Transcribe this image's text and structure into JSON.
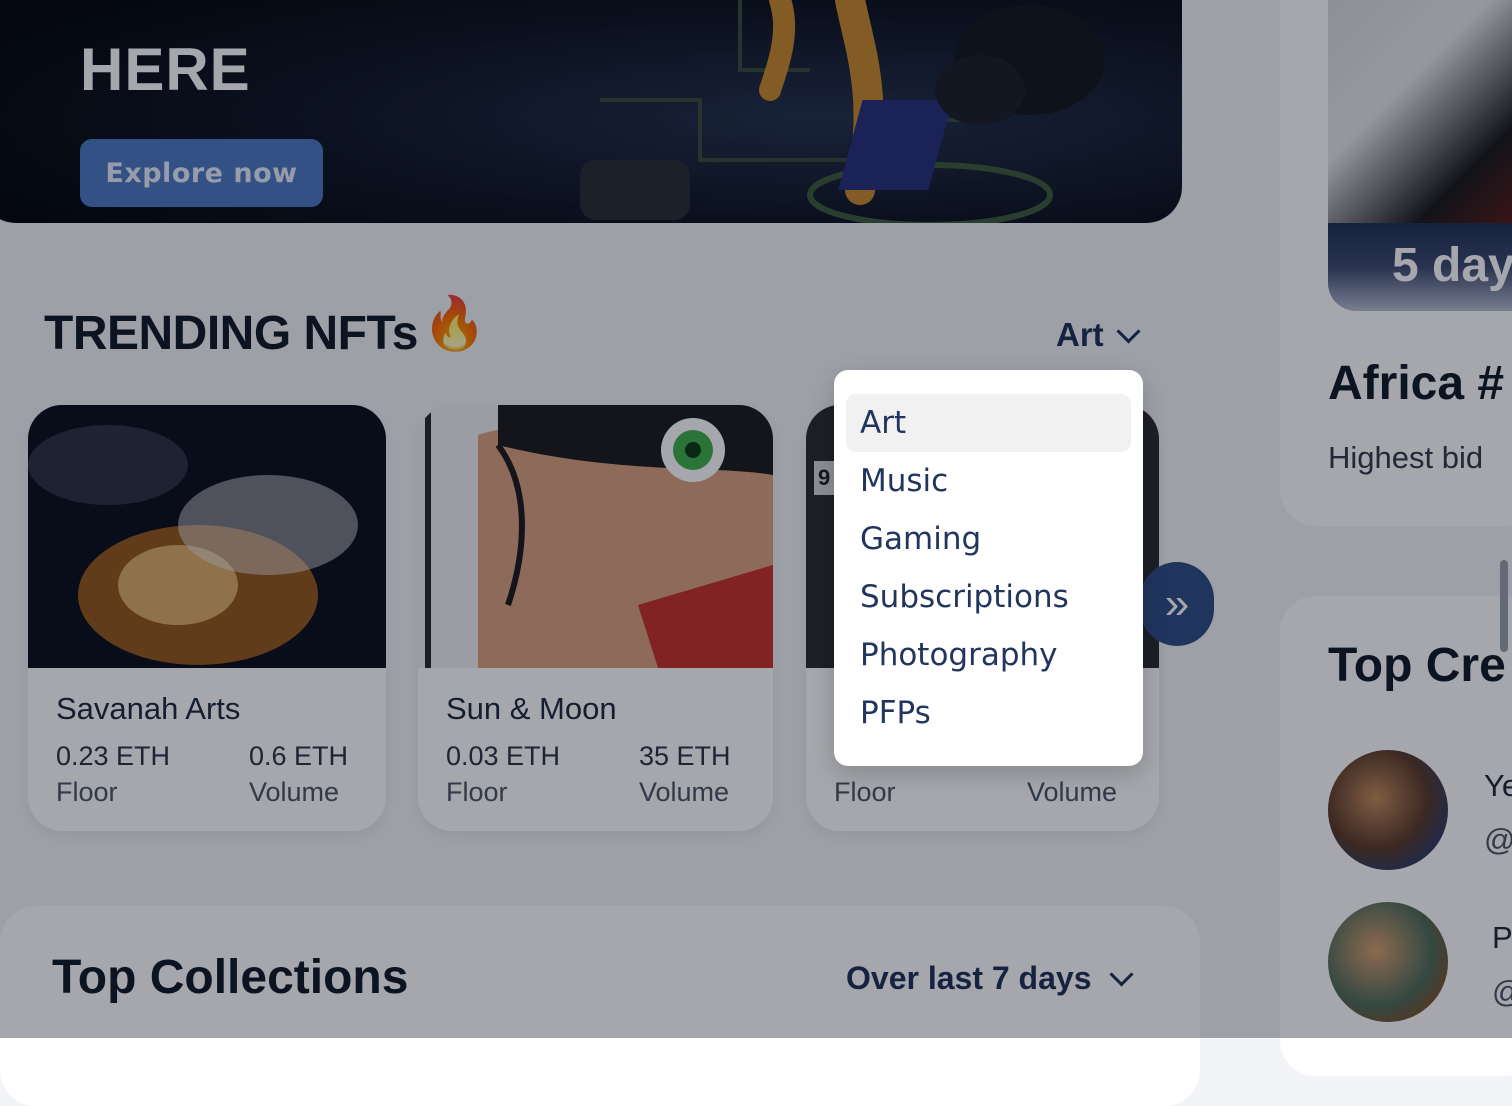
{
  "hero": {
    "title": "HERE",
    "button_label": "Explore now"
  },
  "trending": {
    "title": "TRENDING NFTs",
    "emoji": "🔥",
    "selected_category": "Art",
    "cards": [
      {
        "name": "Savanah Arts",
        "floor_value": "0.23 ETH",
        "volume_value": "0.6 ETH",
        "floor_label": "Floor",
        "volume_label": "Volume"
      },
      {
        "name": "Sun & Moon",
        "floor_value": "0.03 ETH",
        "volume_value": "35 ETH",
        "floor_label": "Floor",
        "volume_label": "Volume"
      },
      {
        "name": "",
        "floor_value": "",
        "volume_value": "",
        "floor_label": "Floor",
        "volume_label": "Volume",
        "corner_text": "9"
      }
    ],
    "next_icon": "»"
  },
  "category_dropdown": {
    "options": [
      "Art",
      "Music",
      "Gaming",
      "Subscriptions",
      "Photography",
      "PFPs"
    ],
    "selected": "Art"
  },
  "top_collections": {
    "title": "Top Collections",
    "filter": "Over last 7 days"
  },
  "sidebar": {
    "auction": {
      "countdown": "5 day",
      "title": "Africa #",
      "subtitle": "Highest bid"
    },
    "top_creators": {
      "title": "Top Cre",
      "creators": [
        {
          "name": "Ye",
          "handle": "@"
        },
        {
          "name": "P",
          "handle": "@"
        }
      ]
    }
  },
  "colors": {
    "accent": "#2f4d86",
    "button": "#4f79c4",
    "text_dark": "#111827",
    "dropdown_text": "#22355e"
  }
}
